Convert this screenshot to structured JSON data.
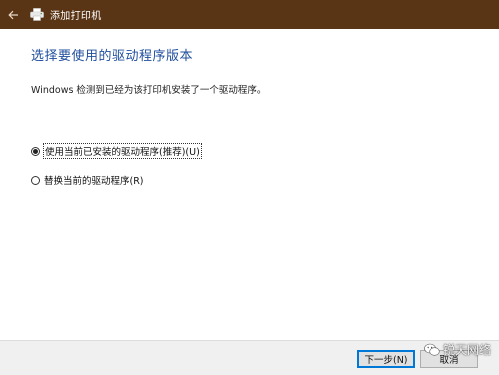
{
  "window": {
    "title": "添加打印机",
    "titlebar_color": "#5a3515",
    "back_icon": "back-arrow-icon",
    "title_icon": "printer-icon"
  },
  "main": {
    "heading": "选择要使用的驱动程序版本",
    "description": "Windows 检测到已经为该打印机安装了一个驱动程序。",
    "options": [
      {
        "label": "使用当前已安装的驱动程序(推荐)(U)",
        "selected": true
      },
      {
        "label": "替换当前的驱动程序(R)",
        "selected": false
      }
    ]
  },
  "footer": {
    "next_label": "下一步(N)",
    "cancel_label": "取消"
  },
  "watermark": {
    "text": "锐天网络"
  },
  "colors": {
    "heading": "#1f4e9c",
    "accent": "#0078d7"
  }
}
